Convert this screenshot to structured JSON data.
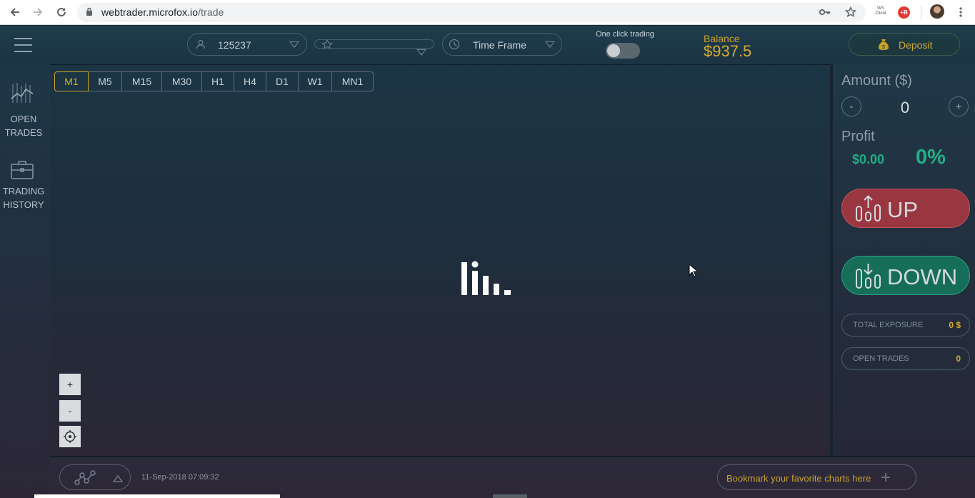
{
  "browser": {
    "url_host": "webtrader.microfox.io",
    "url_path": "/trade",
    "ext_ws": "WS Client",
    "ext_b": "+B"
  },
  "header": {
    "account_id": "125237",
    "time_frame_label": "Time Frame",
    "one_click_label": "One click trading",
    "one_click_enabled": false,
    "balance_label": "Balance",
    "balance_value": "$937.5",
    "deposit_label": "Deposit"
  },
  "sidebar": {
    "items": [
      {
        "line1": "OPEN",
        "line2": "TRADES",
        "icon": "chart-lines-icon"
      },
      {
        "line1": "TRADING",
        "line2": "HISTORY",
        "icon": "briefcase-icon"
      }
    ]
  },
  "timeframes": {
    "active": "M1",
    "items": [
      "M1",
      "M5",
      "M15",
      "M30",
      "H1",
      "H4",
      "D1",
      "W1",
      "MN1"
    ]
  },
  "zoom": {
    "plus": "+",
    "minus": "-"
  },
  "panel": {
    "amount_label": "Amount ($)",
    "minus": "-",
    "plus": "+",
    "amount_value": "0",
    "profit_label": "Profit",
    "profit_money": "$0.00",
    "profit_pct": "0%",
    "up_label": "UP",
    "down_label": "DOWN",
    "total_exposure_label": "TOTAL EXPOSURE",
    "total_exposure_value": "0 $",
    "open_trades_label": "OPEN TRADES",
    "open_trades_value": "0"
  },
  "footer": {
    "timestamp": "11-Sep-2018 07:09:32",
    "bookmark_label": "Bookmark your favorite charts here",
    "bookmark_plus": "+"
  },
  "colors": {
    "accent_gold": "#d6ac2c",
    "up_red": "#9a3640",
    "down_green": "#166d58",
    "profit_green": "#1fae86"
  }
}
